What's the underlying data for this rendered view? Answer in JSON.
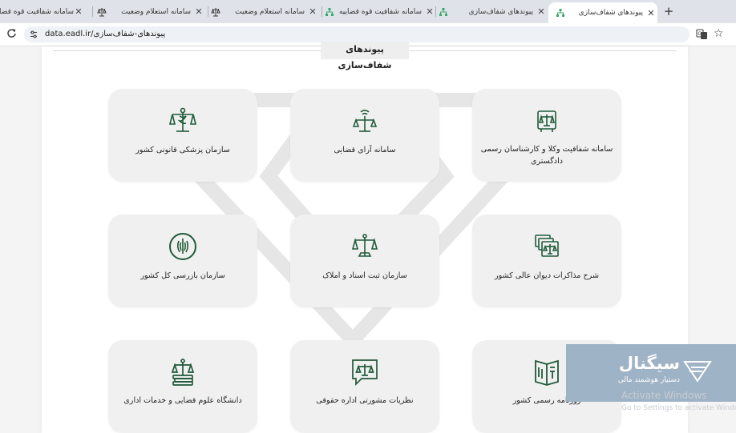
{
  "browser": {
    "tabs": [
      {
        "title": "سامانه شفافیت قوه قضاییه",
        "icon": "scales-icon",
        "active": false
      },
      {
        "title": "سامانه استعلام وضعیت",
        "icon": "scales-icon",
        "active": false
      },
      {
        "title": "سامانه استعلام وضعیت",
        "icon": "scales-icon",
        "active": false
      },
      {
        "title": "سامانه شفافیت قوه قضاییه",
        "icon": "network-icon",
        "active": false
      },
      {
        "title": "پیوندهای شفاف‌سازی",
        "icon": "network-icon",
        "active": false
      },
      {
        "title": "پیوندهای شفاف‌سازی",
        "icon": "network-icon",
        "active": true
      }
    ],
    "new_tab_symbol": "+",
    "url_domain": "data.eadl.ir/",
    "url_path": "پیوندهای-شفاف‌سازی"
  },
  "page": {
    "title": "پیوندهای شفاف‌سازی",
    "cards": [
      {
        "label": "سامانه شفافیت وکلا و کارشناسان رسمی دادگستری",
        "icon": "book-scales-icon"
      },
      {
        "label": "سامانه آرای قضایی",
        "icon": "scales-broadcast-icon"
      },
      {
        "label": "سازمان پزشکی قانونی کشور",
        "icon": "scales-caduceus-icon"
      },
      {
        "label": "شرح مذاکرات دیوان عالی کشور",
        "icon": "documents-scales-icon"
      },
      {
        "label": "سازمان ثبت اسناد و املاک",
        "icon": "scales-icon"
      },
      {
        "label": "سازمان بازرسی کل کشور",
        "icon": "emblem-icon"
      },
      {
        "label": "روزنامه رسمی کشور",
        "icon": "open-book-icon"
      },
      {
        "label": "نظریات مشورتی اداره حقوقی",
        "icon": "chat-scales-icon"
      },
      {
        "label": "دانشگاه علوم قضایی و خدمات اداری",
        "icon": "scales-books-icon"
      }
    ]
  },
  "overlay": {
    "brand_name": "سیگنال",
    "brand_tagline": "دستیار هوشمند مالی",
    "activate_title": "Activate Windows",
    "activate_sub": "Go to Settings to activate Windows."
  },
  "colors": {
    "icon_green": "#1f5a3a",
    "card_bg": "#f0f0f0",
    "tabbar_bg": "#dfe3e9"
  }
}
